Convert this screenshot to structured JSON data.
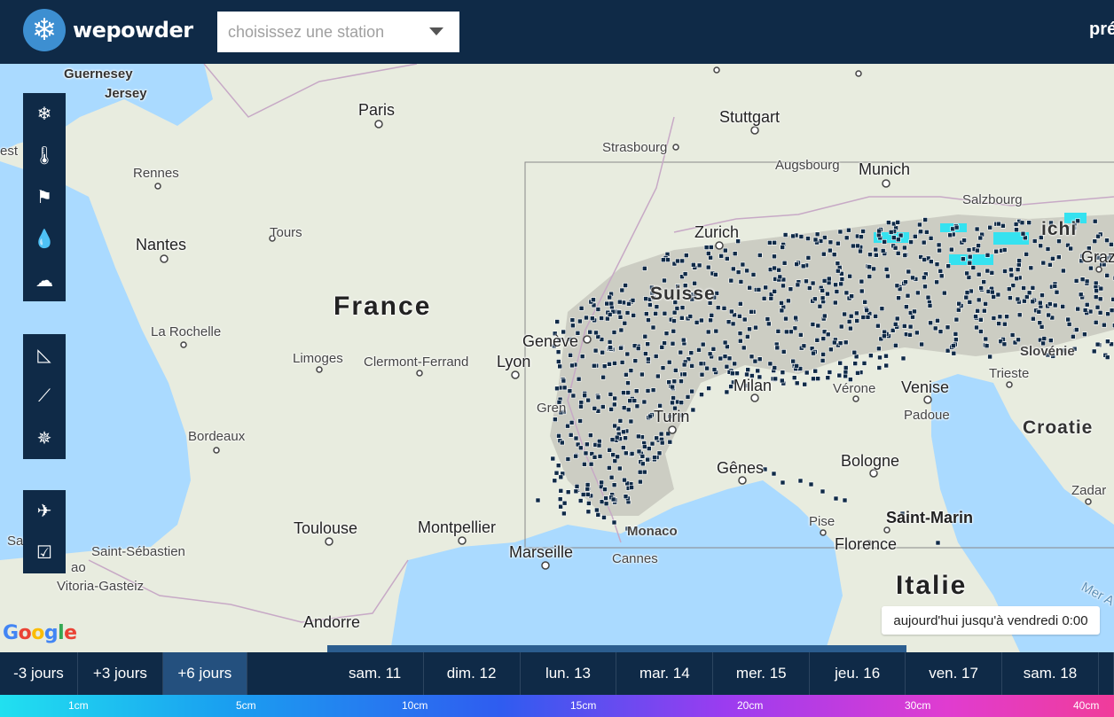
{
  "header": {
    "logo_text": "wepowder",
    "logo_icon": "snowflake-icon",
    "station_placeholder": "choisissez une station",
    "right_text": "pré"
  },
  "map": {
    "labels": {
      "guernesey": "Guernesey",
      "jersey": "Jersey",
      "paris": "Paris",
      "stuttgart": "Stuttgart",
      "strasbourg": "Strasbourg",
      "augsbourg": "Augsbourg",
      "munich": "Munich",
      "salzbourg": "Salzbourg",
      "rennes": "Rennes",
      "nantes": "Nantes",
      "tours": "Tours",
      "france": "France",
      "zurich": "Zurich",
      "suisse": "Suisse",
      "graz": "Graz",
      "la_rochelle": "La Rochelle",
      "limoges": "Limoges",
      "clermont": "Clermont-Ferrand",
      "lyon": "Lyon",
      "geneve": "Genève",
      "slovenie": "Slovénie",
      "trieste": "Trieste",
      "milan": "Milan",
      "verone": "Vérone",
      "venise": "Venise",
      "padoue": "Padoue",
      "grenoble": "Gren",
      "turin": "Turin",
      "croatie": "Croatie",
      "bordeaux": "Bordeaux",
      "genes": "Gênes",
      "bologne": "Bologne",
      "zadar": "Zadar",
      "saint_marin": "Saint-Marin",
      "toulouse": "Toulouse",
      "montpellier": "Montpellier",
      "marseille": "Marseille",
      "monaco": "Monaco",
      "cannes": "Cannes",
      "pise": "Pise",
      "florence": "Florence",
      "saint_sebastien": "Saint-Sébastien",
      "vitoria": "Vitoria-Gasteiz",
      "andorre": "Andorre",
      "italie": "Italie",
      "bilbao": "ao",
      "est": "est",
      "sa": "Sa",
      "ichi": "ichi",
      "mer": "Mer A"
    },
    "period_text": "aujourd'hui jusqu'à vendredi 0:00",
    "colors": {
      "water": "#aadaff",
      "land": "#e8ecdf",
      "alps": "#b9b9b0",
      "station_marker": "#0f2a47",
      "snow_highlight": "#35e2f0"
    }
  },
  "tools": {
    "group1": [
      {
        "name": "snowflake-icon",
        "glyph": "❄"
      },
      {
        "name": "thermometer-icon",
        "glyph": "🌡"
      },
      {
        "name": "wind-icon",
        "glyph": "⚑"
      },
      {
        "name": "drop-icon",
        "glyph": "💧"
      },
      {
        "name": "cloud-icon",
        "glyph": "☁"
      }
    ],
    "group2": [
      {
        "name": "slope-icon",
        "glyph": "◺"
      },
      {
        "name": "chart-slope-icon",
        "glyph": "⟋"
      },
      {
        "name": "compass-icon",
        "glyph": "✵"
      }
    ],
    "group3": [
      {
        "name": "satellite-icon",
        "glyph": "✈"
      },
      {
        "name": "checkbox-icon",
        "glyph": "☑"
      }
    ]
  },
  "timebar": {
    "ranges": [
      "-3 jours",
      "+3 jours",
      "+6 jours"
    ],
    "active_range": "+6 jours",
    "days": [
      "sam. 11",
      "dim. 12",
      "lun. 13",
      "mar. 14",
      "mer. 15",
      "jeu. 16",
      "ven. 17",
      "sam. 18"
    ],
    "progress_percent": 75
  },
  "scale": {
    "labels": [
      "1cm",
      "5cm",
      "10cm",
      "15cm",
      "20cm",
      "30cm",
      "40cm"
    ]
  }
}
